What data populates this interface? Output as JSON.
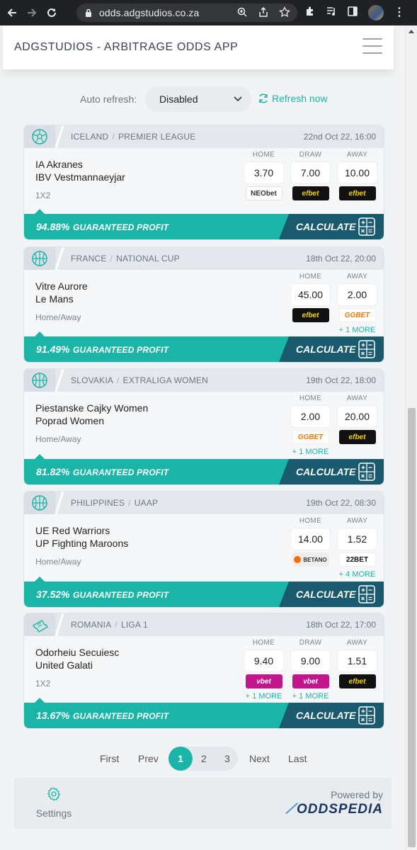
{
  "browser": {
    "url": "odds.adgstudios.co.za"
  },
  "header": {
    "brand": "ADGSTUDIOS - ARBITRAGE ODDS APP"
  },
  "controls": {
    "auto_refresh_label": "Auto refresh:",
    "auto_refresh_value": "Disabled",
    "refresh_now_label": "Refresh now"
  },
  "cards": [
    {
      "sport": "soccer",
      "country": "ICELAND",
      "league": "PREMIER LEAGUE",
      "date": "22nd Oct 22, 16:00",
      "home_team": "IA Akranes",
      "away_team": "IBV Vestmannaeyjar",
      "market": "1X2",
      "odds": [
        {
          "label": "HOME",
          "value": "3.70",
          "bookmaker": "NEObet",
          "more": ""
        },
        {
          "label": "DRAW",
          "value": "7.00",
          "bookmaker": "efbet",
          "more": ""
        },
        {
          "label": "AWAY",
          "value": "10.00",
          "bookmaker": "efbet",
          "more": ""
        }
      ],
      "profit_pct": "94.88%",
      "profit_label": "GUARANTEED PROFIT",
      "calculate_label": "CALCULATE"
    },
    {
      "sport": "basketball",
      "country": "FRANCE",
      "league": "NATIONAL CUP",
      "date": "18th Oct 22, 20:00",
      "home_team": "Vitre Aurore",
      "away_team": "Le Mans",
      "market": "Home/Away",
      "odds": [
        {
          "label": "HOME",
          "value": "45.00",
          "bookmaker": "efbet",
          "more": ""
        },
        {
          "label": "AWAY",
          "value": "2.00",
          "bookmaker": "GGBET",
          "more": "+ 1 MORE"
        }
      ],
      "profit_pct": "91.49%",
      "profit_label": "GUARANTEED PROFIT",
      "calculate_label": "CALCULATE"
    },
    {
      "sport": "basketball",
      "country": "SLOVAKIA",
      "league": "EXTRALIGA WOMEN",
      "date": "19th Oct 22, 18:00",
      "home_team": "Piestanske Cajky Women",
      "away_team": "Poprad Women",
      "market": "Home/Away",
      "odds": [
        {
          "label": "HOME",
          "value": "2.00",
          "bookmaker": "GGBET",
          "more": "+ 1 MORE"
        },
        {
          "label": "AWAY",
          "value": "20.00",
          "bookmaker": "efbet",
          "more": ""
        }
      ],
      "profit_pct": "81.82%",
      "profit_label": "GUARANTEED PROFIT",
      "calculate_label": "CALCULATE"
    },
    {
      "sport": "basketball",
      "country": "PHILIPPINES",
      "league": "UAAP",
      "date": "19th Oct 22, 08:30",
      "home_team": "UE Red Warriors",
      "away_team": "UP Fighting Maroons",
      "market": "Home/Away",
      "odds": [
        {
          "label": "HOME",
          "value": "14.00",
          "bookmaker": "BETANO",
          "more": ""
        },
        {
          "label": "AWAY",
          "value": "1.52",
          "bookmaker": "22BET",
          "more": "+ 4 MORE"
        }
      ],
      "profit_pct": "37.52%",
      "profit_label": "GUARANTEED PROFIT",
      "calculate_label": "CALCULATE"
    },
    {
      "sport": "ticket",
      "country": "ROMANIA",
      "league": "LIGA 1",
      "date": "18th Oct 22, 17:00",
      "home_team": "Odorheiu Secuiesc",
      "away_team": "United Galati",
      "market": "1X2",
      "odds": [
        {
          "label": "HOME",
          "value": "9.40",
          "bookmaker": "vbet",
          "more": "+ 1 MORE"
        },
        {
          "label": "DRAW",
          "value": "9.00",
          "bookmaker": "vbet",
          "more": "+ 1 MORE"
        },
        {
          "label": "AWAY",
          "value": "1.51",
          "bookmaker": "efbet",
          "more": ""
        }
      ],
      "profit_pct": "13.67%",
      "profit_label": "GUARANTEED PROFIT",
      "calculate_label": "CALCULATE"
    }
  ],
  "pagination": {
    "first": "First",
    "prev": "Prev",
    "pages": [
      "1",
      "2",
      "3"
    ],
    "current": "1",
    "next": "Next",
    "last": "Last"
  },
  "footer": {
    "settings_label": "Settings",
    "powered_by": "Powered by",
    "logo_text": "ODDSPEDIA"
  },
  "colors": {
    "accent": "#1bb5a8",
    "calculate_bg": "#1a5a6e"
  }
}
